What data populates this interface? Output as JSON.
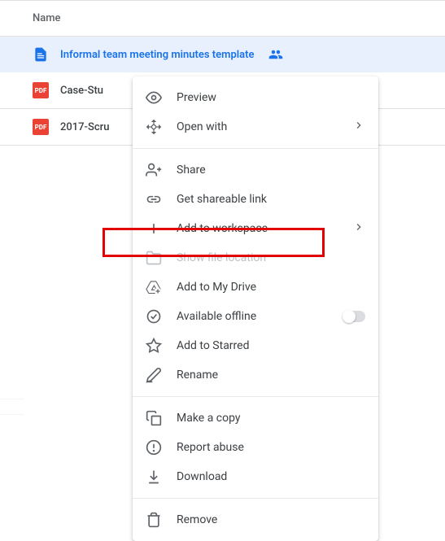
{
  "header": {
    "name_col": "Name"
  },
  "files": [
    {
      "name": "Informal team meeting minutes template",
      "type": "doc",
      "shared": true,
      "selected": true
    },
    {
      "name": "Case-Stu",
      "type": "pdf",
      "shared": false,
      "selected": false
    },
    {
      "name": "2017-Scru",
      "type": "pdf",
      "shared": false,
      "selected": false
    }
  ],
  "menu": {
    "preview": "Preview",
    "open_with": "Open with",
    "share": "Share",
    "get_link": "Get shareable link",
    "add_workspace": "Add to workspace",
    "show_location": "Show file location",
    "add_my_drive": "Add to My Drive",
    "available_offline": "Available offline",
    "add_starred": "Add to Starred",
    "rename": "Rename",
    "make_copy": "Make a copy",
    "report_abuse": "Report abuse",
    "download": "Download",
    "remove": "Remove"
  },
  "pdf_label": "PDF"
}
